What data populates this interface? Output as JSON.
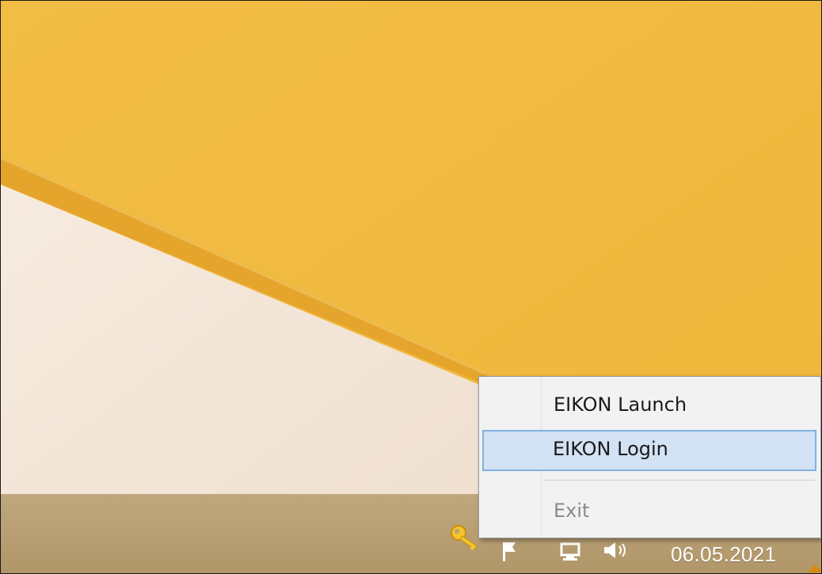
{
  "context_menu": {
    "items": [
      {
        "label": "EIKON Launch",
        "state": "normal"
      },
      {
        "label": "EIKON Login",
        "state": "highlighted"
      },
      {
        "label": "Exit",
        "state": "disabled"
      }
    ]
  },
  "taskbar": {
    "date": "06.05.2021",
    "tray_icons": [
      "key-icon",
      "flag-icon",
      "network-icon",
      "speaker-icon",
      "show-hidden-icons-arrow"
    ]
  },
  "colors": {
    "wallpaper_yellow": "#f0b93d",
    "wallpaper_cream": "#f3e4d6",
    "taskbar": "#b89f73",
    "menu_background": "#f2f2f2",
    "menu_highlight": "#d3e2f4",
    "menu_highlight_border": "#82b0e4"
  }
}
